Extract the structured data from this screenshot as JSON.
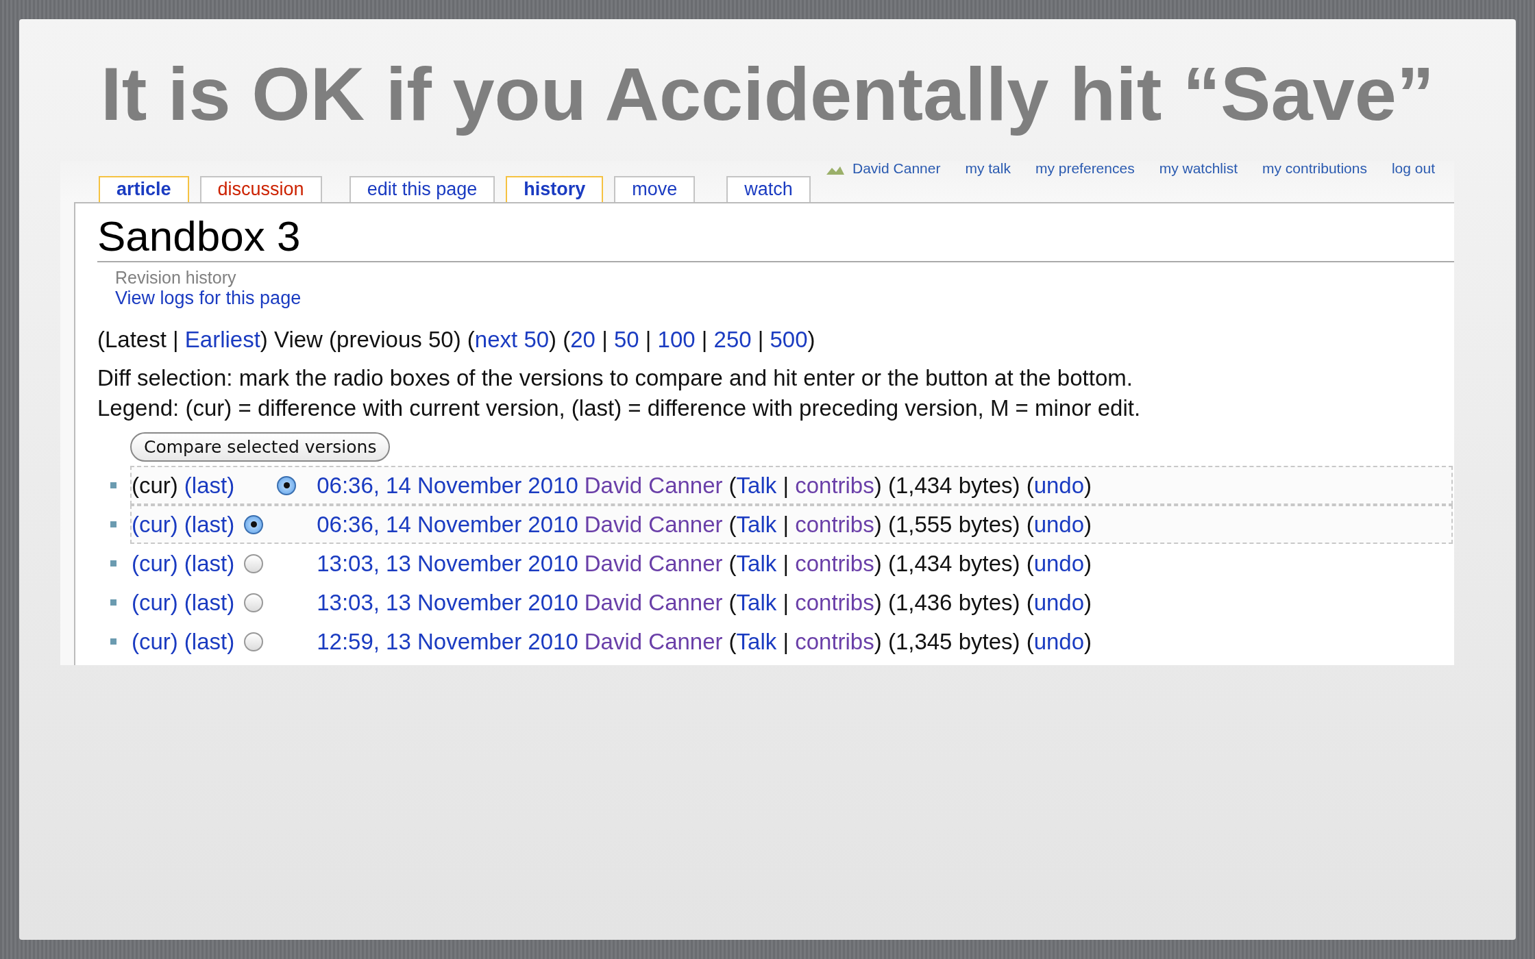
{
  "slide_title": "It is OK if you Accidentally hit “Save”",
  "personal_links": [
    "David Canner",
    "my talk",
    "my preferences",
    "my watchlist",
    "my contributions",
    "log out"
  ],
  "tabs": [
    {
      "label": "article",
      "selected": true,
      "kind": "page",
      "color": "#1a3bc1"
    },
    {
      "label": "discussion",
      "selected": false,
      "kind": "page",
      "color": "#cc2200"
    },
    {
      "label": "edit this page",
      "selected": false,
      "kind": "action",
      "color": "#1a3bc1"
    },
    {
      "label": "history",
      "selected": true,
      "kind": "action",
      "color": "#1a3bc1"
    },
    {
      "label": "move",
      "selected": false,
      "kind": "action",
      "color": "#1a3bc1"
    },
    {
      "label": "watch",
      "selected": false,
      "kind": "extra",
      "color": "#1a3bc1"
    }
  ],
  "page_title": "Sandbox 3",
  "subtitle": "Revision history",
  "logs_link": "View logs for this page",
  "nav": [
    {
      "text": "(Latest | ",
      "link": false
    },
    {
      "text": "Earliest",
      "link": true
    },
    {
      "text": ") View (previous 50) (",
      "link": false
    },
    {
      "text": "next 50",
      "link": true
    },
    {
      "text": ") (",
      "link": false
    },
    {
      "text": "20",
      "link": true
    },
    {
      "text": " | ",
      "link": false
    },
    {
      "text": "50",
      "link": true
    },
    {
      "text": " | ",
      "link": false
    },
    {
      "text": "100",
      "link": true
    },
    {
      "text": " | ",
      "link": false
    },
    {
      "text": "250",
      "link": true
    },
    {
      "text": " | ",
      "link": false
    },
    {
      "text": "500",
      "link": true
    },
    {
      "text": ")",
      "link": false
    }
  ],
  "instructions": "Diff selection: mark the radio boxes of the versions to compare and hit enter or the button at the bottom.",
  "legend": "Legend: (cur) = difference with current version, (last) = difference with preceding version, M = minor edit.",
  "compare_button": "Compare selected versions",
  "revisions": [
    {
      "cur": "(cur)",
      "cur_link": false,
      "last": "(last)",
      "radio": {
        "kind": "newer",
        "selected": true
      },
      "highlighted": true,
      "date": "06:36, 14 November 2010",
      "user": "David Canner",
      "tools": [
        {
          "text": "(",
          "kind": "text"
        },
        {
          "text": "Talk",
          "kind": "link"
        },
        {
          "text": " | ",
          "kind": "text"
        },
        {
          "text": "contribs",
          "kind": "visited"
        },
        {
          "text": ") (1,434 bytes) (",
          "kind": "text"
        },
        {
          "text": "undo",
          "kind": "link"
        },
        {
          "text": ")",
          "kind": "text"
        }
      ]
    },
    {
      "cur": "(cur)",
      "cur_link": true,
      "last": "(last)",
      "radio": {
        "kind": "older",
        "selected": true
      },
      "highlighted": true,
      "date": "06:36, 14 November 2010",
      "user": "David Canner",
      "tools": [
        {
          "text": "(",
          "kind": "text"
        },
        {
          "text": "Talk",
          "kind": "link"
        },
        {
          "text": " | ",
          "kind": "text"
        },
        {
          "text": "contribs",
          "kind": "visited"
        },
        {
          "text": ") (1,555 bytes) (",
          "kind": "text"
        },
        {
          "text": "undo",
          "kind": "link"
        },
        {
          "text": ")",
          "kind": "text"
        }
      ]
    },
    {
      "cur": "(cur)",
      "cur_link": true,
      "last": "(last)",
      "radio": {
        "kind": "older",
        "selected": false
      },
      "highlighted": false,
      "date": "13:03, 13 November 2010",
      "user": "David Canner",
      "tools": [
        {
          "text": "(",
          "kind": "text"
        },
        {
          "text": "Talk",
          "kind": "link"
        },
        {
          "text": " | ",
          "kind": "text"
        },
        {
          "text": "contribs",
          "kind": "visited"
        },
        {
          "text": ") (1,434 bytes) (",
          "kind": "text"
        },
        {
          "text": "undo",
          "kind": "link"
        },
        {
          "text": ")",
          "kind": "text"
        }
      ]
    },
    {
      "cur": "(cur)",
      "cur_link": true,
      "last": "(last)",
      "radio": {
        "kind": "older",
        "selected": false
      },
      "highlighted": false,
      "date": "13:03, 13 November 2010",
      "user": "David Canner",
      "tools": [
        {
          "text": "(",
          "kind": "text"
        },
        {
          "text": "Talk",
          "kind": "link"
        },
        {
          "text": " | ",
          "kind": "text"
        },
        {
          "text": "contribs",
          "kind": "visited"
        },
        {
          "text": ") (1,436 bytes) (",
          "kind": "text"
        },
        {
          "text": "undo",
          "kind": "link"
        },
        {
          "text": ")",
          "kind": "text"
        }
      ]
    },
    {
      "cur": "(cur)",
      "cur_link": true,
      "last": "(last)",
      "radio": {
        "kind": "older",
        "selected": false
      },
      "highlighted": false,
      "date": "12:59, 13 November 2010",
      "user": "David Canner",
      "tools": [
        {
          "text": "(",
          "kind": "text"
        },
        {
          "text": "Talk",
          "kind": "link"
        },
        {
          "text": " | ",
          "kind": "text"
        },
        {
          "text": "contribs",
          "kind": "visited"
        },
        {
          "text": ") (1,345 bytes) (",
          "kind": "text"
        },
        {
          "text": "undo",
          "kind": "link"
        },
        {
          "text": ")",
          "kind": "text"
        }
      ]
    }
  ]
}
